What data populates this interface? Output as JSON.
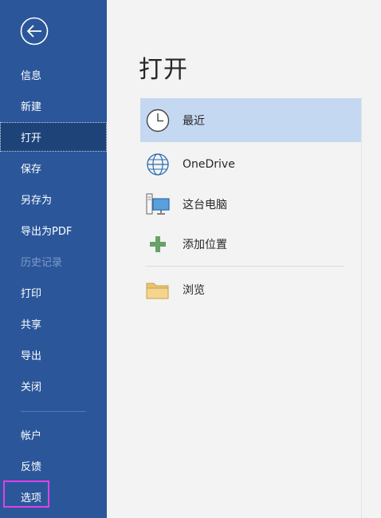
{
  "sidebar": {
    "back_icon": "back-arrow-icon",
    "items": [
      {
        "label": "信息"
      },
      {
        "label": "新建"
      },
      {
        "label": "打开"
      },
      {
        "label": "保存"
      },
      {
        "label": "另存为"
      },
      {
        "label": "导出为PDF"
      },
      {
        "label": "历史记录"
      },
      {
        "label": "打印"
      },
      {
        "label": "共享"
      },
      {
        "label": "导出"
      },
      {
        "label": "关闭"
      }
    ],
    "bottom_items": [
      {
        "label": "帐户"
      },
      {
        "label": "反馈"
      },
      {
        "label": "选项"
      }
    ],
    "selected": "打开",
    "disabled": "历史记录"
  },
  "main": {
    "title": "打开",
    "locations": [
      {
        "label": "最近",
        "icon": "clock-icon"
      },
      {
        "label": "OneDrive",
        "icon": "globe-icon"
      },
      {
        "label": "这台电脑",
        "icon": "computer-icon"
      },
      {
        "label": "添加位置",
        "icon": "plus-icon"
      },
      {
        "label": "浏览",
        "icon": "folder-icon"
      }
    ]
  },
  "colors": {
    "sidebar_bg": "#2b579a",
    "selected_nav_bg": "#1e4379",
    "selected_location_bg": "#c5d8f2",
    "highlight_box": "#e040e8"
  }
}
